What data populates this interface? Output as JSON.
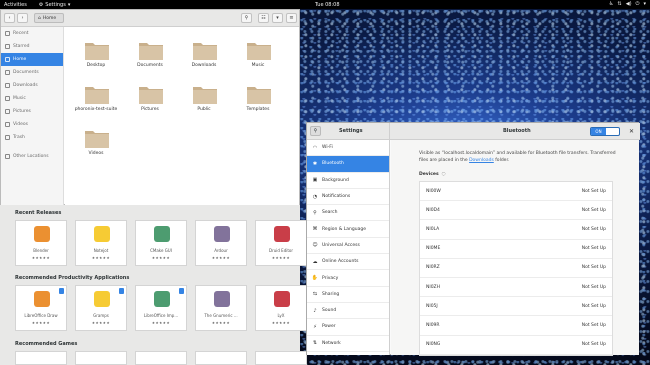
{
  "topbar": {
    "activities": "Activities",
    "app_menu": "Settings",
    "clock": "Tue 08:08"
  },
  "files": {
    "breadcrumb": "Home",
    "sidebar": [
      {
        "label": "Recent",
        "active": false
      },
      {
        "label": "Starred",
        "active": false
      },
      {
        "label": "Home",
        "active": true
      },
      {
        "label": "Documents",
        "active": false
      },
      {
        "label": "Downloads",
        "active": false
      },
      {
        "label": "Music",
        "active": false
      },
      {
        "label": "Pictures",
        "active": false
      },
      {
        "label": "Videos",
        "active": false
      },
      {
        "label": "Trash",
        "active": false
      },
      {
        "label": "Other Locations",
        "active": false
      }
    ],
    "folders": [
      "Desktop",
      "Documents",
      "Downloads",
      "Music",
      "phoronix-test-suite",
      "Pictures",
      "Public",
      "Templates",
      "Videos"
    ]
  },
  "software": {
    "recent_header": "Recent Releases",
    "productivity_header": "Recommended Productivity Applications",
    "games_header": "Recommended Games",
    "recent": [
      "Blender",
      "Notejot",
      "CMake GUI",
      "Ardour",
      "Druid Editor"
    ],
    "productivity": [
      "LibreOffice Draw",
      "Gramps",
      "LibreOffice Imp...",
      "The Gnumeric ...",
      "LyX"
    ],
    "stars": "★★★★★"
  },
  "settings": {
    "sidebar_title": "Settings",
    "panel_title": "Bluetooth",
    "toggle_label": "ON",
    "sidebar": [
      {
        "label": "Wi-Fi",
        "active": false
      },
      {
        "label": "Bluetooth",
        "active": true
      },
      {
        "label": "Background",
        "active": false
      },
      {
        "label": "Notifications",
        "active": false
      },
      {
        "label": "Search",
        "active": false
      },
      {
        "label": "Region & Language",
        "active": false
      },
      {
        "label": "Universal Access",
        "active": false
      },
      {
        "label": "Online Accounts",
        "active": false
      },
      {
        "label": "Privacy",
        "active": false
      },
      {
        "label": "Sharing",
        "active": false
      },
      {
        "label": "Sound",
        "active": false
      },
      {
        "label": "Power",
        "active": false
      },
      {
        "label": "Network",
        "active": false
      }
    ],
    "desc_before": "Visible as “localhost.localdomain” and available for Bluetooth file transfers. Transferred files are placed in the ",
    "desc_link": "Downloads",
    "desc_after": " folder.",
    "devices_label": "Devices",
    "devices": [
      {
        "name": "NI00W",
        "status": "Not Set Up"
      },
      {
        "name": "NI0D4",
        "status": "Not Set Up"
      },
      {
        "name": "NI0LA",
        "status": "Not Set Up"
      },
      {
        "name": "NI0ME",
        "status": "Not Set Up"
      },
      {
        "name": "NI0RZ",
        "status": "Not Set Up"
      },
      {
        "name": "NI0ZH",
        "status": "Not Set Up"
      },
      {
        "name": "NI05J",
        "status": "Not Set Up"
      },
      {
        "name": "NI09R",
        "status": "Not Set Up"
      },
      {
        "name": "NI0NG",
        "status": "Not Set Up"
      }
    ]
  },
  "colors": {
    "accent": "#3584e4",
    "folder": "#d8c4a6"
  }
}
